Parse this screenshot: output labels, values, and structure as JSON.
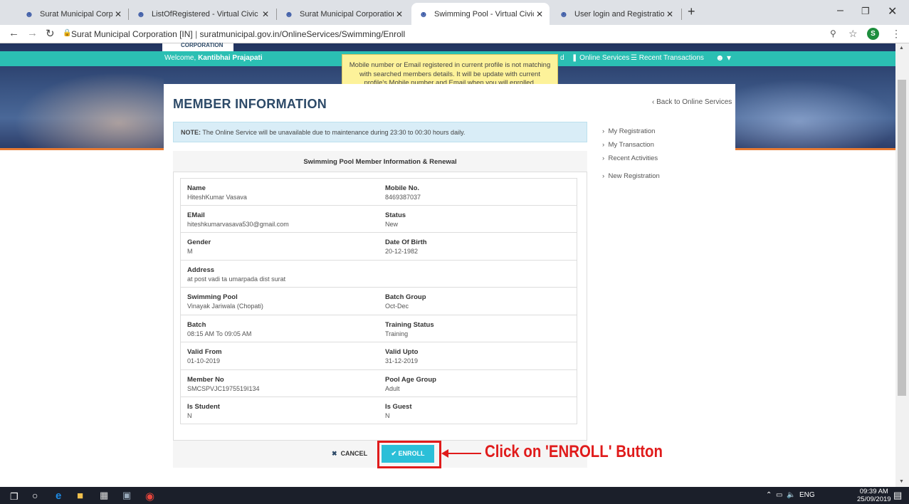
{
  "browser": {
    "tabs": [
      {
        "label": "Surat Municipal Corporation",
        "active": false
      },
      {
        "label": "ListOfRegistered - Virtual Civic C",
        "active": false
      },
      {
        "label": "Surat Municipal Corporation",
        "active": false
      },
      {
        "label": "Swimming Pool - Virtual Civic Ce",
        "active": true
      },
      {
        "label": "User login and Registration - Virt",
        "active": false
      }
    ],
    "url_site": "Surat Municipal Corporation [IN]",
    "url_path": "suratmunicipal.gov.in/OnlineServices/Swimming/Enroll",
    "profile_initial": "S"
  },
  "header": {
    "logo_text": "CORPORATION",
    "welcome_prefix": "Welcome,",
    "user_name": "Kantibhai Prajapati",
    "nav_partial": "d",
    "nav_online_services": "Online Services",
    "nav_recent_transactions": "Recent Transactions"
  },
  "tooltip": "Mobile number or Email registered in current profile is not matching with searched members details. It will be update with current profile's Mobile number and Email when you will enrolled.",
  "page": {
    "title": "MEMBER INFORMATION",
    "back_link": "‹ Back to Online Services",
    "note_label": "NOTE:",
    "note_text": " The Online Service will be unavailable due to maintenance during 23:30 to 00:30 hours daily.",
    "panel_title": "Swimming Pool Member Information & Renewal"
  },
  "sidebar": {
    "items": [
      {
        "label": "My Registration"
      },
      {
        "label": "My Transaction"
      },
      {
        "label": "Recent Activities"
      },
      {
        "label": "New Registration"
      }
    ]
  },
  "member": {
    "rows": [
      [
        {
          "label": "Name",
          "value": "HiteshKumar Vasava"
        },
        {
          "label": "Mobile No.",
          "value": "8469387037"
        }
      ],
      [
        {
          "label": "EMail",
          "value": "hiteshkumarvasava530@gmail.com"
        },
        {
          "label": "Status",
          "value": "New"
        }
      ],
      [
        {
          "label": "Gender",
          "value": "M"
        },
        {
          "label": "Date Of Birth",
          "value": "20-12-1982"
        }
      ],
      [
        {
          "label": "Address",
          "value": "at post vadi ta umarpada dist surat"
        }
      ],
      [
        {
          "label": "Swimming Pool",
          "value": "Vinayak Jariwala (Chopati)"
        },
        {
          "label": "Batch Group",
          "value": "Oct-Dec"
        }
      ],
      [
        {
          "label": "Batch",
          "value": "08:15 AM To 09:05 AM"
        },
        {
          "label": "Training Status",
          "value": "Training"
        }
      ],
      [
        {
          "label": "Valid From",
          "value": "01-10-2019"
        },
        {
          "label": "Valid Upto",
          "value": "31-12-2019"
        }
      ],
      [
        {
          "label": "Member No",
          "value": "SMCSPVJC1975519I134"
        },
        {
          "label": "Pool Age Group",
          "value": "Adult"
        }
      ],
      [
        {
          "label": "Is Student",
          "value": "N"
        },
        {
          "label": "Is Guest",
          "value": "N"
        }
      ]
    ]
  },
  "actions": {
    "cancel_label": "CANCEL",
    "enroll_label": "ENROLL"
  },
  "annotation": {
    "callout": "Click on 'ENROLL' Button",
    "color": "#e01b1b"
  },
  "taskbar": {
    "language": "ENG",
    "time": "09:39 AM",
    "date": "25/09/2019"
  },
  "colors": {
    "teal_nav": "#2bbfb3",
    "title_blue": "#2d4a68",
    "enroll_button": "#2bbfd8",
    "tooltip_yellow": "#fdf29a",
    "note_blue": "#d9edf7"
  }
}
